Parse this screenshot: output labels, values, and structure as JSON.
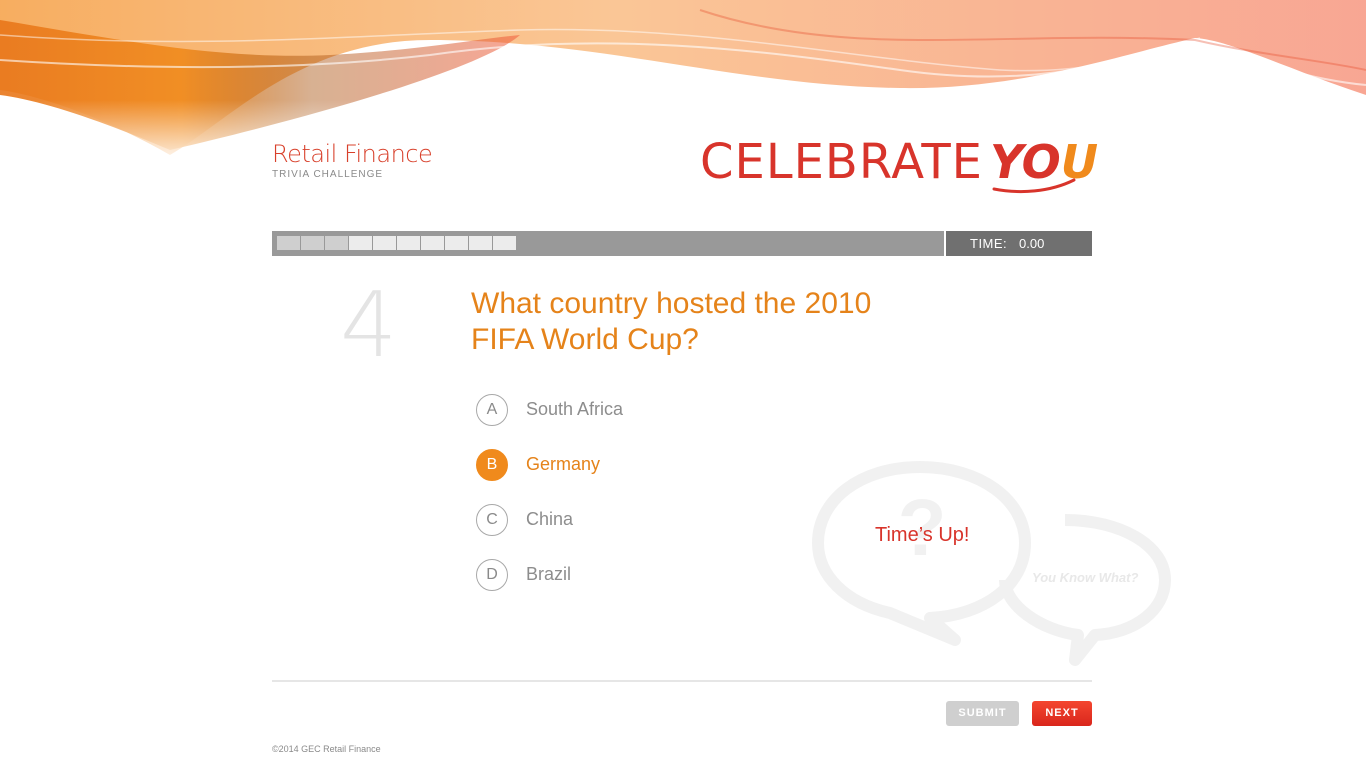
{
  "header": {
    "brand_title": "Retail Finance",
    "brand_subtitle": "TRIVIA CHALLENGE",
    "campaign_word": "CELEBRATE",
    "campaign_you_yo": "YO",
    "campaign_you_u": "U"
  },
  "progress": {
    "segments_done": 3,
    "segments_total": 10,
    "timer_label": "TIME:",
    "timer_value": "0.00"
  },
  "question": {
    "number": "4",
    "text": "What country hosted the 2010 FIFA World Cup?"
  },
  "answers": [
    {
      "letter": "A",
      "text": "South Africa",
      "selected": false
    },
    {
      "letter": "B",
      "text": "Germany",
      "selected": true
    },
    {
      "letter": "C",
      "text": "China",
      "selected": false
    },
    {
      "letter": "D",
      "text": "Brazil",
      "selected": false
    }
  ],
  "feedback": {
    "message": "Time’s Up!",
    "watermark": "You Know What?"
  },
  "buttons": {
    "submit": "SUBMIT",
    "next": "NEXT"
  },
  "footer": {
    "copyright": "©2014 GEC Retail Finance"
  },
  "colors": {
    "accent_orange": "#f08a1c",
    "brand_red": "#d8342b",
    "timer_bg": "#707070",
    "progress_bg": "#999999"
  }
}
